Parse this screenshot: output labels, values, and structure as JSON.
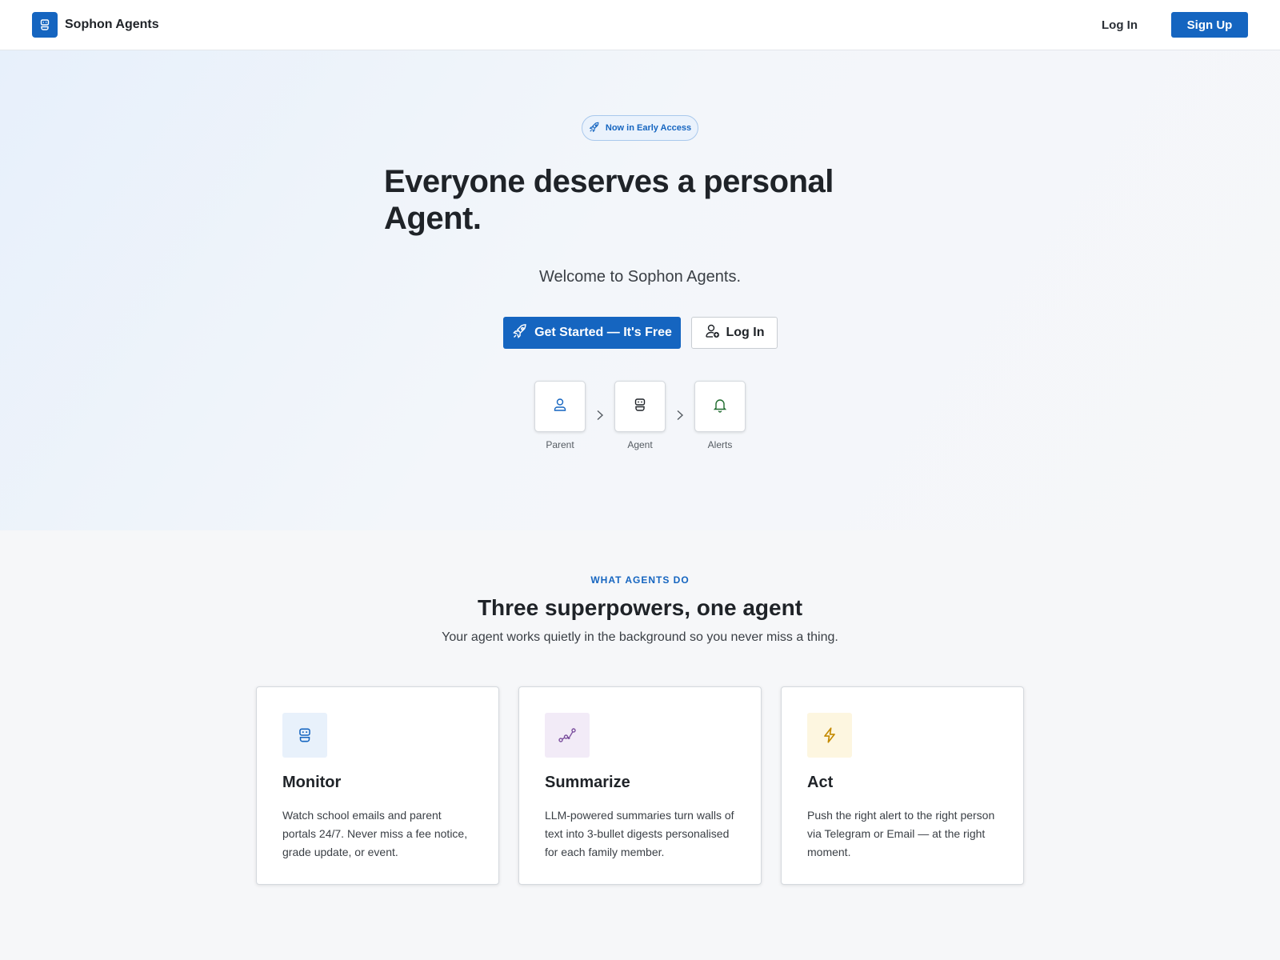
{
  "header": {
    "brand_name": "Sophon Agents",
    "login_label": "Log In",
    "signup_label": "Sign Up"
  },
  "hero": {
    "badge_text": "Now in Early Access",
    "title": "Everyone deserves a personal Agent.",
    "subtitle": "Welcome to Sophon Agents.",
    "primary_cta": "Get Started — It's Free",
    "secondary_cta": "Log In",
    "flow": [
      {
        "label": "Parent",
        "icon": "user-icon"
      },
      {
        "label": "Agent",
        "icon": "robot-icon"
      },
      {
        "label": "Alerts",
        "icon": "bell-icon"
      }
    ]
  },
  "features": {
    "eyebrow": "WHAT AGENTS DO",
    "title": "Three superpowers, one agent",
    "subtitle": "Your agent works quietly in the background so you never miss a thing.",
    "cards": [
      {
        "title": "Monitor",
        "body": "Watch school emails and parent portals 24/7. Never miss a fee notice, grade update, or event.",
        "icon": "robot-icon",
        "icon_bg": "#e8f1fb",
        "icon_color": "#1565c0"
      },
      {
        "title": "Summarize",
        "body": "LLM-powered summaries turn walls of text into 3-bullet digests personalised for each family member.",
        "icon": "graph-icon",
        "icon_bg": "#f2ebf7",
        "icon_color": "#7b4f9e"
      },
      {
        "title": "Act",
        "body": "Push the right alert to the right person via Telegram or Email — at the right moment.",
        "icon": "lightning-icon",
        "icon_bg": "#fdf6e0",
        "icon_color": "#c48a00"
      }
    ]
  },
  "colors": {
    "accent": "#1565c0",
    "text": "#1f2328"
  }
}
